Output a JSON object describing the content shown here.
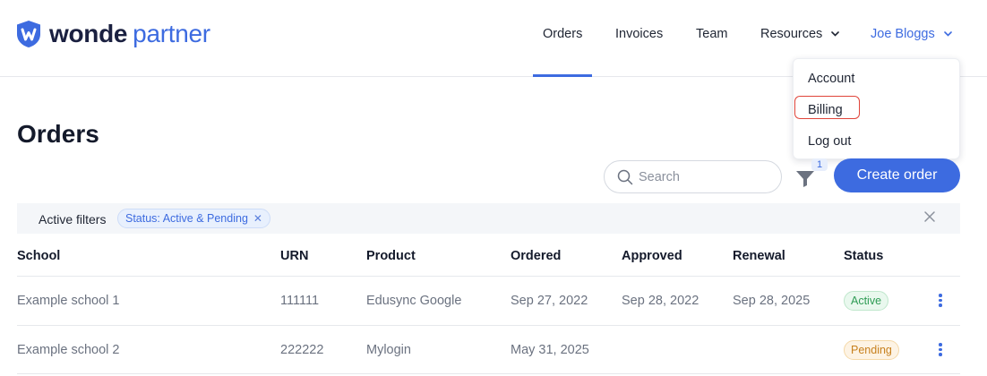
{
  "brand": {
    "name": "wonde",
    "suffix": "partner",
    "accent_color": "#3d6be0"
  },
  "nav": {
    "items": [
      {
        "label": "Orders",
        "active": true
      },
      {
        "label": "Invoices"
      },
      {
        "label": "Team"
      },
      {
        "label": "Resources",
        "icon": "chevron-down-icon"
      }
    ],
    "user": {
      "label": "Joe Bloggs",
      "icon": "chevron-down-icon"
    }
  },
  "user_dropdown": {
    "items": [
      {
        "label": "Account"
      },
      {
        "label": "Billing",
        "highlighted": true
      },
      {
        "label": "Log out"
      }
    ]
  },
  "page": {
    "title": "Orders"
  },
  "toolbar": {
    "search_placeholder": "Search",
    "filter_count": "1",
    "create_label": "Create order"
  },
  "filters": {
    "label": "Active filters",
    "chips": [
      {
        "label": "Status: Active & Pending"
      }
    ]
  },
  "table": {
    "headers": [
      "School",
      "URN",
      "Product",
      "Ordered",
      "Approved",
      "Renewal",
      "Status"
    ],
    "rows": [
      {
        "school": "Example school 1",
        "urn": "111111",
        "product": "Edusync Google",
        "ordered": "Sep 27, 2022",
        "approved": "Sep 28, 2022",
        "renewal": "Sep 28, 2025",
        "status": "Active",
        "status_color": "#2f9c55"
      },
      {
        "school": "Example school 2",
        "urn": "222222",
        "product": "Mylogin",
        "ordered": "May 31, 2025",
        "approved": "",
        "renewal": "",
        "status": "Pending",
        "status_color": "#c7801d"
      }
    ]
  }
}
